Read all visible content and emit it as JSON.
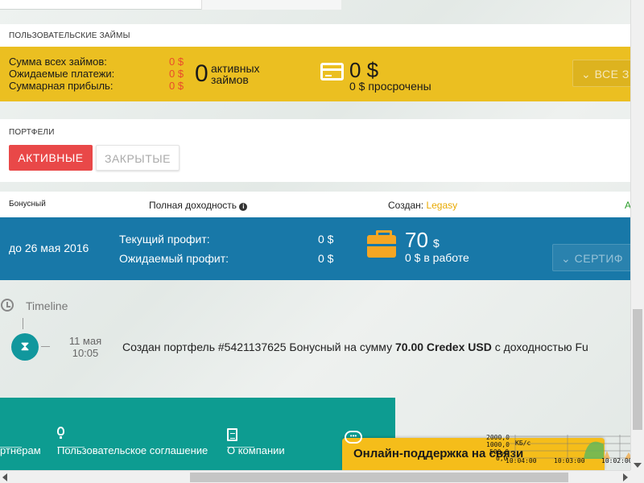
{
  "loans": {
    "caption": "ПОЛЬЗОВАТЕЛЬСКИЕ ЗАЙМЫ",
    "sum_label": "Сумма всех займов:",
    "sum_value": "0 $",
    "expected_label": "Ожидаемые платежи:",
    "expected_value": "0 $",
    "profit_label": "Суммарная прибыль:",
    "profit_value": "0 $",
    "active_count": "0",
    "active_label": "активных займов",
    "amount": "0 $",
    "overdue": "0 $ просрочены",
    "all_button": "ВСЕ З",
    "card_icon": "credit-card-icon"
  },
  "portfolios": {
    "caption": "ПОРТФЕЛИ",
    "tab_active": "АКТИВНЫЕ",
    "tab_closed": "ЗАКРЫТЫЕ",
    "row": {
      "name": "Бонусный",
      "full_yield_label": "Полная доходность",
      "created_label": "Создан:",
      "created_by": "Legasy",
      "status_letter": "А"
    },
    "bar": {
      "until": "до 26 мая 2016",
      "current_profit_label": "Текущий профит:",
      "current_profit_value": "0 $",
      "expected_profit_label": "Ожидаемый профит:",
      "expected_profit_value": "0 $",
      "amount": "70",
      "amount_unit": "$",
      "in_work": "0 $ в работе",
      "cert_button": "СЕРТИФ",
      "case_icon": "briefcase-icon"
    }
  },
  "timeline": {
    "title": "Timeline",
    "event": {
      "date": "11 мая",
      "time": "10:05",
      "text_prefix": "Создан портфель #5421137625 Бонусный на сумму ",
      "amount": "70.00 Credex USD",
      "text_suffix": " с доходностью Fu"
    }
  },
  "footer": {
    "partners": "ртнерам",
    "agreement": "Пользовательское соглашение",
    "about": "О компании"
  },
  "chat": {
    "label": "Онлайн-поддержка на связи"
  },
  "net_monitor": {
    "y_2000": "2000,0",
    "y_1000": "1000,0",
    "y_500": "500,0",
    "y_0": "0,0",
    "unit": "КБ/с",
    "t1": "10:04:00",
    "t2": "10:03:00",
    "t3": "10:02:00"
  }
}
